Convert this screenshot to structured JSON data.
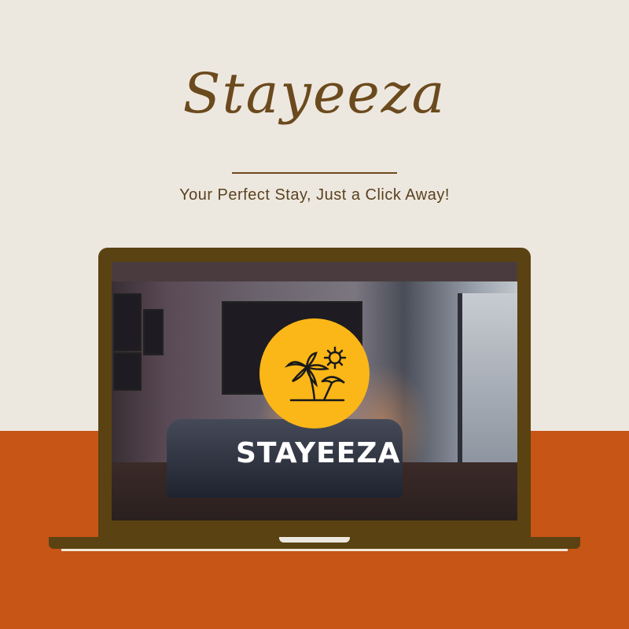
{
  "header": {
    "title": "Stayeeza",
    "tagline": "Your Perfect Stay, Just a Click Away!"
  },
  "screen": {
    "logo_icon": "palm-beach-sun-icon",
    "brand": "STAYEEZA"
  },
  "colors": {
    "background": "#ede8df",
    "accent": "#c65516",
    "laptop": "#5b4212",
    "logo": "#fbb717",
    "text": "#6b4a1e"
  }
}
